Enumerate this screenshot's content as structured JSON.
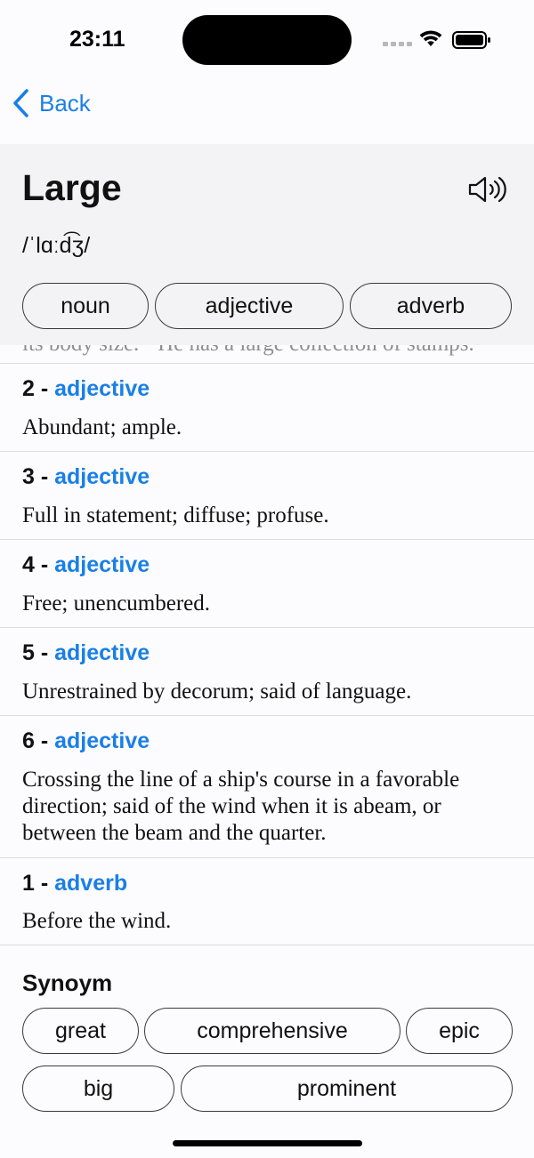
{
  "status": {
    "time": "23:11"
  },
  "nav": {
    "back_label": "Back"
  },
  "word": {
    "title": "Large",
    "phonetic": "/ˈlɑːd͡ʒ/",
    "parts_of_speech": [
      "noun",
      "adjective",
      "adverb"
    ]
  },
  "definitions": {
    "cut_off_text": "its body size. · He has a large collection of stamps.",
    "items": [
      {
        "number": "2 - ",
        "pos": "adjective",
        "text": "Abundant; ample."
      },
      {
        "number": "3 - ",
        "pos": "adjective",
        "text": "Full in statement; diffuse; profuse."
      },
      {
        "number": "4 - ",
        "pos": "adjective",
        "text": "Free; unencumbered."
      },
      {
        "number": "5 - ",
        "pos": "adjective",
        "text": "Unrestrained by decorum; said of language."
      },
      {
        "number": "6 - ",
        "pos": "adjective",
        "text": "Crossing the line of a ship's course in a favorable direction; said of the wind when it is abeam, or between the beam and the quarter."
      },
      {
        "number": "1 - ",
        "pos": "adverb",
        "text": "Before the wind."
      }
    ]
  },
  "synonyms": {
    "title": "Synoym",
    "items": [
      "great",
      "comprehensive",
      "epic",
      "big",
      "prominent"
    ]
  },
  "colors": {
    "accent": "#1a7fe6",
    "header_bg": "#f3f3f5",
    "page_bg": "#fcfcfe"
  },
  "icons": {
    "back": "chevron-left-icon",
    "speaker": "speaker-wave-icon"
  }
}
